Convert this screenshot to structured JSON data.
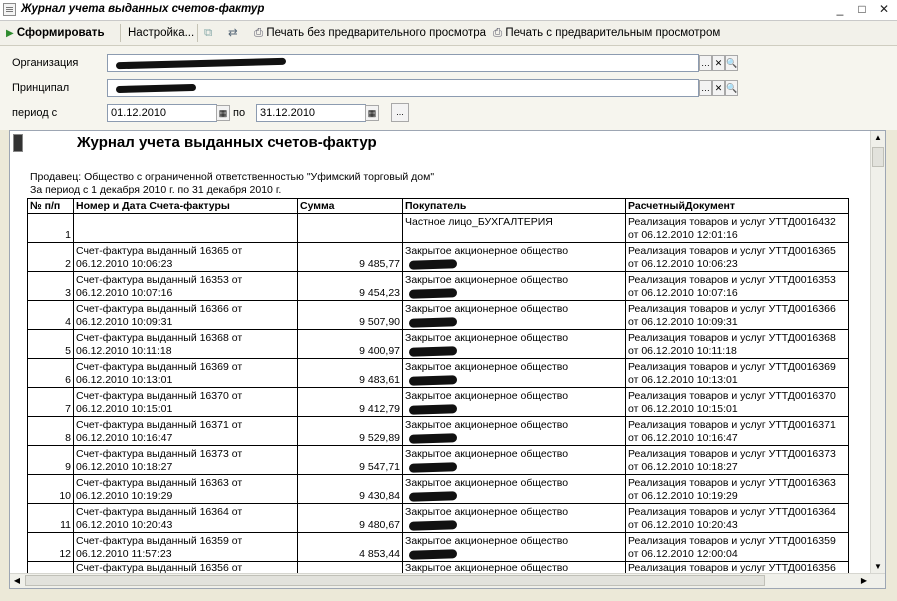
{
  "window": {
    "title": "Журнал учета выданных счетов-фактур"
  },
  "toolbar": {
    "form_label": "Сформировать",
    "settings_label": "Настройка...",
    "print_no_preview": "Печать без предварительного просмотра",
    "print_preview": "Печать с предварительным просмотром"
  },
  "form": {
    "org_label": "Организация",
    "principal_label": "Принципал",
    "period_label": "период с",
    "date_from": "01.12.2010",
    "to_label": "по",
    "date_to": "31.12.2010",
    "more_button": "..."
  },
  "report": {
    "title": "Журнал учета выданных счетов-фактур",
    "seller_line": "Продавец: Общество с ограниченной ответственностью \"Уфимский торговый дом\"",
    "period_line": "За период с 1 декабря 2010 г. по 31 декабря 2010 г.",
    "columns": [
      "№ п/п",
      "Номер и Дата Счета-фактуры",
      "Сумма",
      "Покупатель",
      "РасчетныйДокумент"
    ],
    "rows": [
      {
        "n": "1",
        "inv1": "",
        "inv2": "",
        "sum": "",
        "buyer": "Частное лицо_БУХГАЛТЕРИЯ",
        "doc1": "Реализация товаров и услуг УТТД0016432",
        "doc2": "от 06.12.2010 12:01:16"
      },
      {
        "n": "2",
        "inv1": "Счет-фактура выданный 16365 от",
        "inv2": "06.12.2010 10:06:23",
        "sum": "9 485,77",
        "buyer": "Закрытое акционерное общество",
        "doc1": "Реализация товаров и услуг УТТД0016365",
        "doc2": "от 06.12.2010 10:06:23"
      },
      {
        "n": "3",
        "inv1": "Счет-фактура выданный 16353 от",
        "inv2": "06.12.2010 10:07:16",
        "sum": "9 454,23",
        "buyer": "Закрытое акционерное общество",
        "doc1": "Реализация товаров и услуг УТТД0016353",
        "doc2": "от 06.12.2010 10:07:16"
      },
      {
        "n": "4",
        "inv1": "Счет-фактура выданный 16366 от",
        "inv2": "06.12.2010 10:09:31",
        "sum": "9 507,90",
        "buyer": "Закрытое акционерное общество",
        "doc1": "Реализация товаров и услуг УТТД0016366",
        "doc2": "от 06.12.2010 10:09:31"
      },
      {
        "n": "5",
        "inv1": "Счет-фактура выданный 16368 от",
        "inv2": "06.12.2010 10:11:18",
        "sum": "9 400,97",
        "buyer": "Закрытое акционерное общество",
        "doc1": "Реализация товаров и услуг УТТД0016368",
        "doc2": "от 06.12.2010 10:11:18"
      },
      {
        "n": "6",
        "inv1": "Счет-фактура выданный 16369 от",
        "inv2": "06.12.2010 10:13:01",
        "sum": "9 483,61",
        "buyer": "Закрытое акционерное общество",
        "doc1": "Реализация товаров и услуг УТТД0016369",
        "doc2": "от 06.12.2010 10:13:01"
      },
      {
        "n": "7",
        "inv1": "Счет-фактура выданный 16370 от",
        "inv2": "06.12.2010 10:15:01",
        "sum": "9 412,79",
        "buyer": "Закрытое акционерное общество",
        "doc1": "Реализация товаров и услуг УТТД0016370",
        "doc2": "от 06.12.2010 10:15:01"
      },
      {
        "n": "8",
        "inv1": "Счет-фактура выданный 16371 от",
        "inv2": "06.12.2010 10:16:47",
        "sum": "9 529,89",
        "buyer": "Закрытое акционерное общество",
        "doc1": "Реализация товаров и услуг УТТД0016371",
        "doc2": "от 06.12.2010 10:16:47"
      },
      {
        "n": "9",
        "inv1": "Счет-фактура выданный 16373 от",
        "inv2": "06.12.2010 10:18:27",
        "sum": "9 547,71",
        "buyer": "Закрытое акционерное общество",
        "doc1": "Реализация товаров и услуг УТТД0016373",
        "doc2": "от 06.12.2010 10:18:27"
      },
      {
        "n": "10",
        "inv1": "Счет-фактура выданный 16363 от",
        "inv2": "06.12.2010 10:19:29",
        "sum": "9 430,84",
        "buyer": "Закрытое акционерное общество",
        "doc1": "Реализация товаров и услуг УТТД0016363",
        "doc2": "от 06.12.2010 10:19:29"
      },
      {
        "n": "11",
        "inv1": "Счет-фактура выданный 16364 от",
        "inv2": "06.12.2010 10:20:43",
        "sum": "9 480,67",
        "buyer": "Закрытое акционерное общество",
        "doc1": "Реализация товаров и услуг УТТД0016364",
        "doc2": "от 06.12.2010 10:20:43"
      },
      {
        "n": "12",
        "inv1": "Счет-фактура выданный 16359 от",
        "inv2": "06.12.2010 11:57:23",
        "sum": "4 853,44",
        "buyer": "Закрытое акционерное общество",
        "doc1": "Реализация товаров и услуг УТТД0016359",
        "doc2": "от 06.12.2010 12:00:04"
      },
      {
        "n": "",
        "inv1": "Счет-фактура выданный 16356 от",
        "inv2": "",
        "sum": "",
        "buyer": "Закрытое акционерное общество",
        "doc1": "Реализация товаров и услуг УТТД0016356",
        "doc2": ""
      }
    ]
  }
}
